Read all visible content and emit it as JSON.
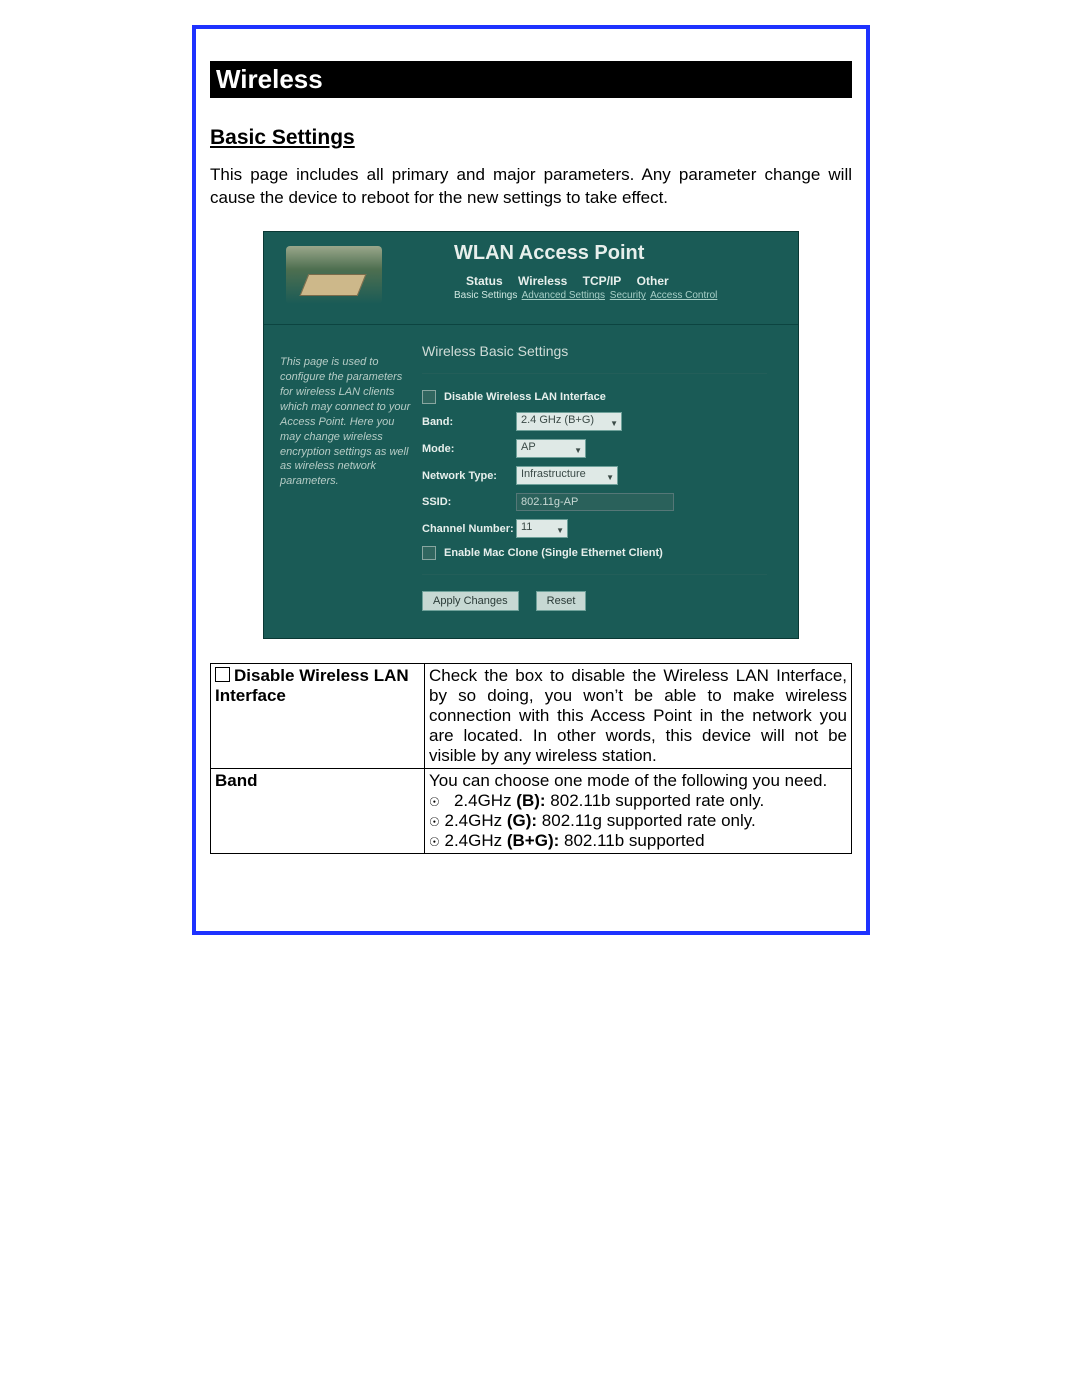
{
  "heading": "Wireless",
  "section": "Basic Settings",
  "intro": "This page includes all primary and major parameters.  Any parameter change will cause the device to reboot for the new settings to take effect.",
  "ap": {
    "title": "WLAN Access Point",
    "nav": [
      "Status",
      "Wireless",
      "TCP/IP",
      "Other"
    ],
    "subnav": {
      "current": "Basic Settings",
      "links": [
        "Advanced Settings",
        "Security",
        "Access Control"
      ]
    },
    "side_help": "This page is used to configure the parameters for wireless LAN clients which may connect to your Access Point. Here you may change wireless encryption settings as well as wireless network parameters.",
    "form_title": "Wireless Basic Settings",
    "disable_label": "Disable Wireless LAN Interface",
    "band_label": "Band:",
    "band_value": "2.4 GHz (B+G)",
    "mode_label": "Mode:",
    "mode_value": "AP",
    "ntype_label": "Network Type:",
    "ntype_value": "Infrastructure",
    "ssid_label": "SSID:",
    "ssid_value": "802.11g-AP",
    "chan_label": "Channel Number:",
    "chan_value": "11",
    "macclone_label": "Enable Mac Clone (Single Ethernet Client)",
    "apply_btn": "Apply Changes",
    "reset_btn": "Reset"
  },
  "table": {
    "row1_label": "Disable Wireless LAN Interface",
    "row1_desc": "Check the box to disable the Wireless LAN Interface, by so doing, you won’t be able to make wireless connection with this Access Point in the network you are located. In other words, this device will not be visible by any wireless station.",
    "row2_label": "Band",
    "row2_intro": "You can choose one mode of the following you need.",
    "row2_b_pre": "2.4GHz ",
    "row2_b_bold": "(B):",
    "row2_b_post": " 802.11b supported rate only.",
    "row2_g_pre": "2.4GHz ",
    "row2_g_bold": "(G):",
    "row2_g_post": " 802.11g supported rate only.",
    "row2_bg_pre": "2.4GHz ",
    "row2_bg_bold": "(B+G):",
    "row2_bg_post": " 802.11b supported"
  }
}
